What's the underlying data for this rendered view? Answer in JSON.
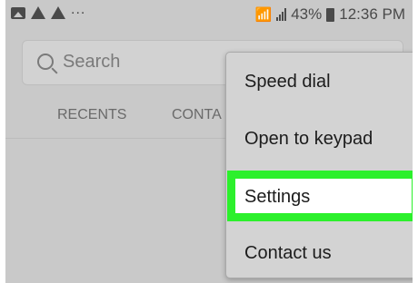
{
  "status_bar": {
    "left_icons": [
      "image-icon",
      "warning-icon",
      "warning-icon"
    ],
    "more": "...",
    "battery_percent": "43%",
    "time": "12:36 PM",
    "right_icons": [
      "wifi-icon",
      "signal-icon",
      "battery-icon"
    ]
  },
  "search": {
    "placeholder": "Search"
  },
  "tabs": [
    {
      "label": "RECENTS"
    },
    {
      "label": "CONTA"
    }
  ],
  "menu": {
    "items": [
      {
        "label": "Speed dial"
      },
      {
        "label": "Open to keypad"
      },
      {
        "label": "Settings",
        "highlighted": true,
        "highlight_color": "#2cf02c"
      },
      {
        "label": "Contact us"
      }
    ]
  }
}
